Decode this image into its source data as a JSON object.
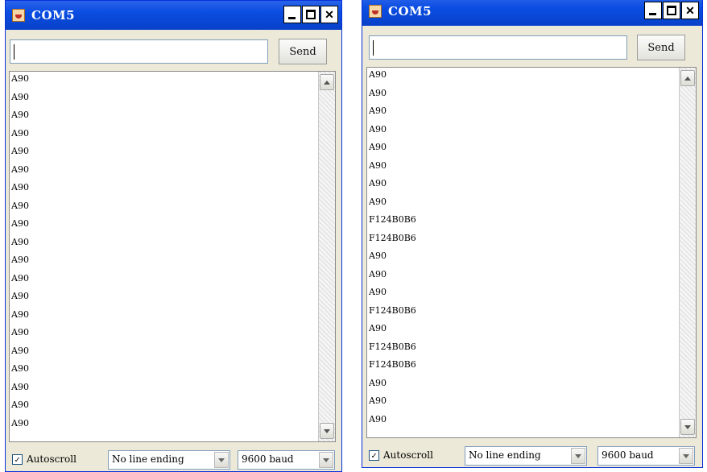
{
  "windows": [
    {
      "title": "COM5",
      "send_label": "Send",
      "input_value": "",
      "lines": [
        "A90",
        "A90",
        "A90",
        "A90",
        "A90",
        "A90",
        "A90",
        "A90",
        "A90",
        "A90",
        "A90",
        "A90",
        "A90",
        "A90",
        "A90",
        "A90",
        "A90",
        "A90",
        "A90",
        "A90"
      ],
      "autoscroll_label": "Autoscroll",
      "autoscroll_checked": true,
      "line_ending": "No line ending",
      "baud": "9600 baud"
    },
    {
      "title": "COM5",
      "send_label": "Send",
      "input_value": "",
      "lines": [
        "A90",
        "A90",
        "A90",
        "A90",
        "A90",
        "A90",
        "A90",
        "A90",
        "F124B0B6",
        "F124B0B6",
        "A90",
        "A90",
        "A90",
        "F124B0B6",
        "A90",
        "F124B0B6",
        "F124B0B6",
        "A90",
        "A90",
        "A90"
      ],
      "autoscroll_label": "Autoscroll",
      "autoscroll_checked": true,
      "line_ending": "No line ending",
      "baud": "9600 baud"
    }
  ]
}
